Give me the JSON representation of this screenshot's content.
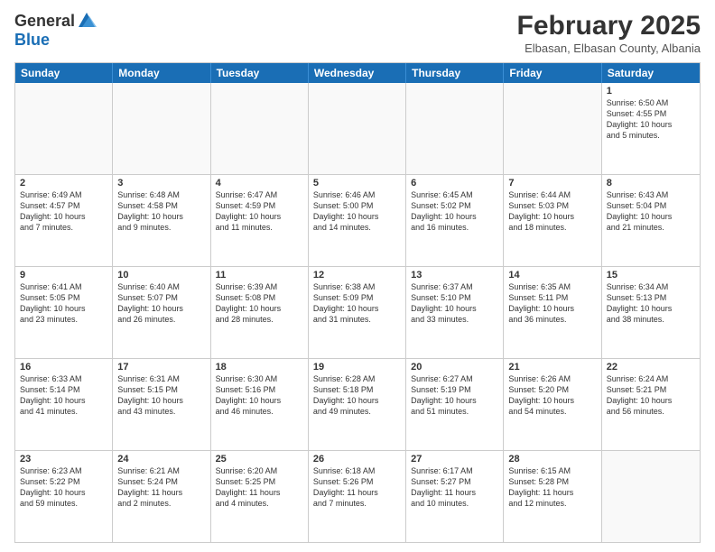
{
  "logo": {
    "general": "General",
    "blue": "Blue"
  },
  "title": "February 2025",
  "location": "Elbasan, Elbasan County, Albania",
  "weekdays": [
    "Sunday",
    "Monday",
    "Tuesday",
    "Wednesday",
    "Thursday",
    "Friday",
    "Saturday"
  ],
  "weeks": [
    [
      {
        "day": "",
        "info": ""
      },
      {
        "day": "",
        "info": ""
      },
      {
        "day": "",
        "info": ""
      },
      {
        "day": "",
        "info": ""
      },
      {
        "day": "",
        "info": ""
      },
      {
        "day": "",
        "info": ""
      },
      {
        "day": "1",
        "info": "Sunrise: 6:50 AM\nSunset: 4:55 PM\nDaylight: 10 hours\nand 5 minutes."
      }
    ],
    [
      {
        "day": "2",
        "info": "Sunrise: 6:49 AM\nSunset: 4:57 PM\nDaylight: 10 hours\nand 7 minutes."
      },
      {
        "day": "3",
        "info": "Sunrise: 6:48 AM\nSunset: 4:58 PM\nDaylight: 10 hours\nand 9 minutes."
      },
      {
        "day": "4",
        "info": "Sunrise: 6:47 AM\nSunset: 4:59 PM\nDaylight: 10 hours\nand 11 minutes."
      },
      {
        "day": "5",
        "info": "Sunrise: 6:46 AM\nSunset: 5:00 PM\nDaylight: 10 hours\nand 14 minutes."
      },
      {
        "day": "6",
        "info": "Sunrise: 6:45 AM\nSunset: 5:02 PM\nDaylight: 10 hours\nand 16 minutes."
      },
      {
        "day": "7",
        "info": "Sunrise: 6:44 AM\nSunset: 5:03 PM\nDaylight: 10 hours\nand 18 minutes."
      },
      {
        "day": "8",
        "info": "Sunrise: 6:43 AM\nSunset: 5:04 PM\nDaylight: 10 hours\nand 21 minutes."
      }
    ],
    [
      {
        "day": "9",
        "info": "Sunrise: 6:41 AM\nSunset: 5:05 PM\nDaylight: 10 hours\nand 23 minutes."
      },
      {
        "day": "10",
        "info": "Sunrise: 6:40 AM\nSunset: 5:07 PM\nDaylight: 10 hours\nand 26 minutes."
      },
      {
        "day": "11",
        "info": "Sunrise: 6:39 AM\nSunset: 5:08 PM\nDaylight: 10 hours\nand 28 minutes."
      },
      {
        "day": "12",
        "info": "Sunrise: 6:38 AM\nSunset: 5:09 PM\nDaylight: 10 hours\nand 31 minutes."
      },
      {
        "day": "13",
        "info": "Sunrise: 6:37 AM\nSunset: 5:10 PM\nDaylight: 10 hours\nand 33 minutes."
      },
      {
        "day": "14",
        "info": "Sunrise: 6:35 AM\nSunset: 5:11 PM\nDaylight: 10 hours\nand 36 minutes."
      },
      {
        "day": "15",
        "info": "Sunrise: 6:34 AM\nSunset: 5:13 PM\nDaylight: 10 hours\nand 38 minutes."
      }
    ],
    [
      {
        "day": "16",
        "info": "Sunrise: 6:33 AM\nSunset: 5:14 PM\nDaylight: 10 hours\nand 41 minutes."
      },
      {
        "day": "17",
        "info": "Sunrise: 6:31 AM\nSunset: 5:15 PM\nDaylight: 10 hours\nand 43 minutes."
      },
      {
        "day": "18",
        "info": "Sunrise: 6:30 AM\nSunset: 5:16 PM\nDaylight: 10 hours\nand 46 minutes."
      },
      {
        "day": "19",
        "info": "Sunrise: 6:28 AM\nSunset: 5:18 PM\nDaylight: 10 hours\nand 49 minutes."
      },
      {
        "day": "20",
        "info": "Sunrise: 6:27 AM\nSunset: 5:19 PM\nDaylight: 10 hours\nand 51 minutes."
      },
      {
        "day": "21",
        "info": "Sunrise: 6:26 AM\nSunset: 5:20 PM\nDaylight: 10 hours\nand 54 minutes."
      },
      {
        "day": "22",
        "info": "Sunrise: 6:24 AM\nSunset: 5:21 PM\nDaylight: 10 hours\nand 56 minutes."
      }
    ],
    [
      {
        "day": "23",
        "info": "Sunrise: 6:23 AM\nSunset: 5:22 PM\nDaylight: 10 hours\nand 59 minutes."
      },
      {
        "day": "24",
        "info": "Sunrise: 6:21 AM\nSunset: 5:24 PM\nDaylight: 11 hours\nand 2 minutes."
      },
      {
        "day": "25",
        "info": "Sunrise: 6:20 AM\nSunset: 5:25 PM\nDaylight: 11 hours\nand 4 minutes."
      },
      {
        "day": "26",
        "info": "Sunrise: 6:18 AM\nSunset: 5:26 PM\nDaylight: 11 hours\nand 7 minutes."
      },
      {
        "day": "27",
        "info": "Sunrise: 6:17 AM\nSunset: 5:27 PM\nDaylight: 11 hours\nand 10 minutes."
      },
      {
        "day": "28",
        "info": "Sunrise: 6:15 AM\nSunset: 5:28 PM\nDaylight: 11 hours\nand 12 minutes."
      },
      {
        "day": "",
        "info": ""
      }
    ]
  ]
}
